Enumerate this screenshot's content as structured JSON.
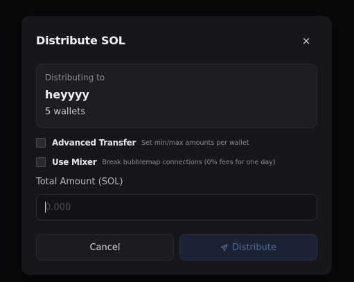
{
  "modal": {
    "title": "Distribute SOL",
    "close_label": "×"
  },
  "info": {
    "label": "Distributing to",
    "group_name": "heyyyy",
    "wallet_count": "5 wallets"
  },
  "options": [
    {
      "label": "Advanced Transfer",
      "description": "Set min/max amounts per wallet",
      "checked": false
    },
    {
      "label": "Use Mixer",
      "description": "Break bubblemap connections (0% fees for one day)",
      "checked": false
    }
  ],
  "amount": {
    "label": "Total Amount (SOL)",
    "value": "",
    "placeholder": "0.000"
  },
  "buttons": {
    "cancel": "Cancel",
    "distribute": "Distribute",
    "distribute_icon": "send-icon"
  },
  "colors": {
    "accent": "#4f6b9a",
    "modal_bg": "#17171b",
    "page_bg": "#09090c"
  }
}
